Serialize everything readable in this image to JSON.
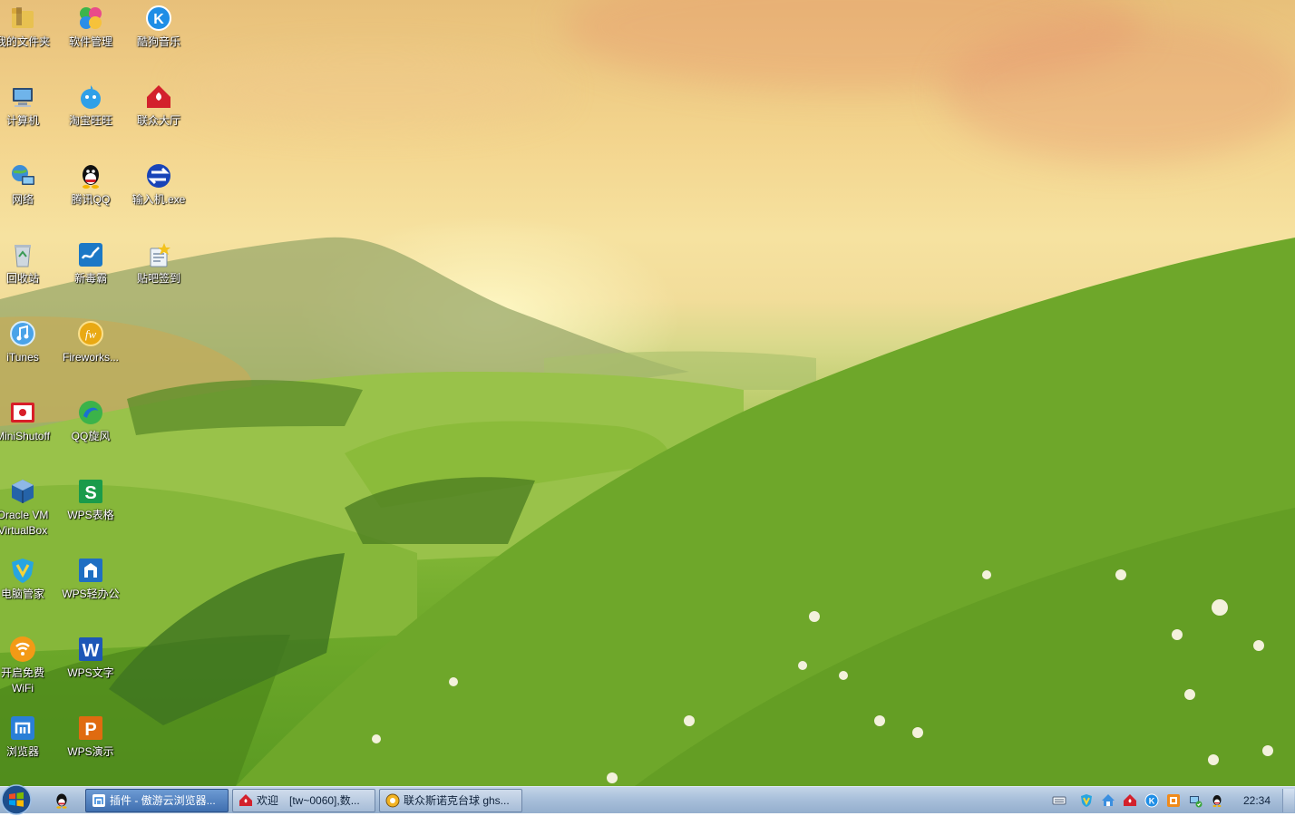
{
  "desktop": {
    "icons": [
      {
        "label": "我的文件夹",
        "icon": "folder-icon"
      },
      {
        "label": "软件管理",
        "icon": "software-manager-icon"
      },
      {
        "label": "酷狗音乐",
        "icon": "kugou-music-icon"
      },
      {
        "label": "计算机",
        "icon": "computer-icon"
      },
      {
        "label": "淘宝旺旺",
        "icon": "wangwang-icon"
      },
      {
        "label": "联众大厅",
        "icon": "ourgame-icon"
      },
      {
        "label": "网络",
        "icon": "network-icon"
      },
      {
        "label": "腾讯QQ",
        "icon": "qq-icon"
      },
      {
        "label": "输入机.exe",
        "icon": "exe-icon"
      },
      {
        "label": "回收站",
        "icon": "recycle-bin-icon"
      },
      {
        "label": "新毒霸",
        "icon": "duba-icon"
      },
      {
        "label": "贴吧签到",
        "icon": "tieba-signin-icon"
      },
      {
        "label": "iTunes",
        "icon": "itunes-icon"
      },
      {
        "label": "Fireworks...",
        "icon": "fireworks-icon"
      },
      {
        "label": "MiniShutoff",
        "icon": "minishutoff-icon"
      },
      {
        "label": "QQ旋风",
        "icon": "qq-xuanfeng-icon"
      },
      {
        "label": "Oracle VM\nVirtualBox",
        "icon": "virtualbox-icon"
      },
      {
        "label": "WPS表格",
        "icon": "wps-sheet-icon"
      },
      {
        "label": "电脑管家",
        "icon": "pc-manager-icon"
      },
      {
        "label": "WPS轻办公",
        "icon": "wps-office-light-icon"
      },
      {
        "label": "开启免费\nWiFi",
        "icon": "free-wifi-icon"
      },
      {
        "label": "WPS文字",
        "icon": "wps-writer-icon"
      },
      {
        "label": "浏览器",
        "icon": "browser-icon"
      },
      {
        "label": "WPS演示",
        "icon": "wps-presentation-icon"
      }
    ]
  },
  "taskbar": {
    "start": {
      "icon": "windows-start-icon"
    },
    "quicklaunch": [
      {
        "icon": "qq-icon"
      }
    ],
    "tasks": [
      {
        "label": "插件 - 傲游云浏览器...",
        "icon": "maxthon-icon",
        "active": true
      },
      {
        "label": "欢迎　[tw~0060],数...",
        "icon": "ourgame-icon",
        "active": false
      },
      {
        "label": "联众斯诺克台球 ghs...",
        "icon": "snooker-icon",
        "active": false
      }
    ],
    "tray": [
      {
        "icon": "keyboard-icon"
      },
      {
        "icon": "pc-manager-icon"
      },
      {
        "icon": "home-icon"
      },
      {
        "icon": "ourgame-icon"
      },
      {
        "icon": "kugou-icon"
      },
      {
        "icon": "wps-icon"
      },
      {
        "icon": "network-status-icon"
      },
      {
        "icon": "qq-icon"
      }
    ],
    "clock": "22:34"
  }
}
